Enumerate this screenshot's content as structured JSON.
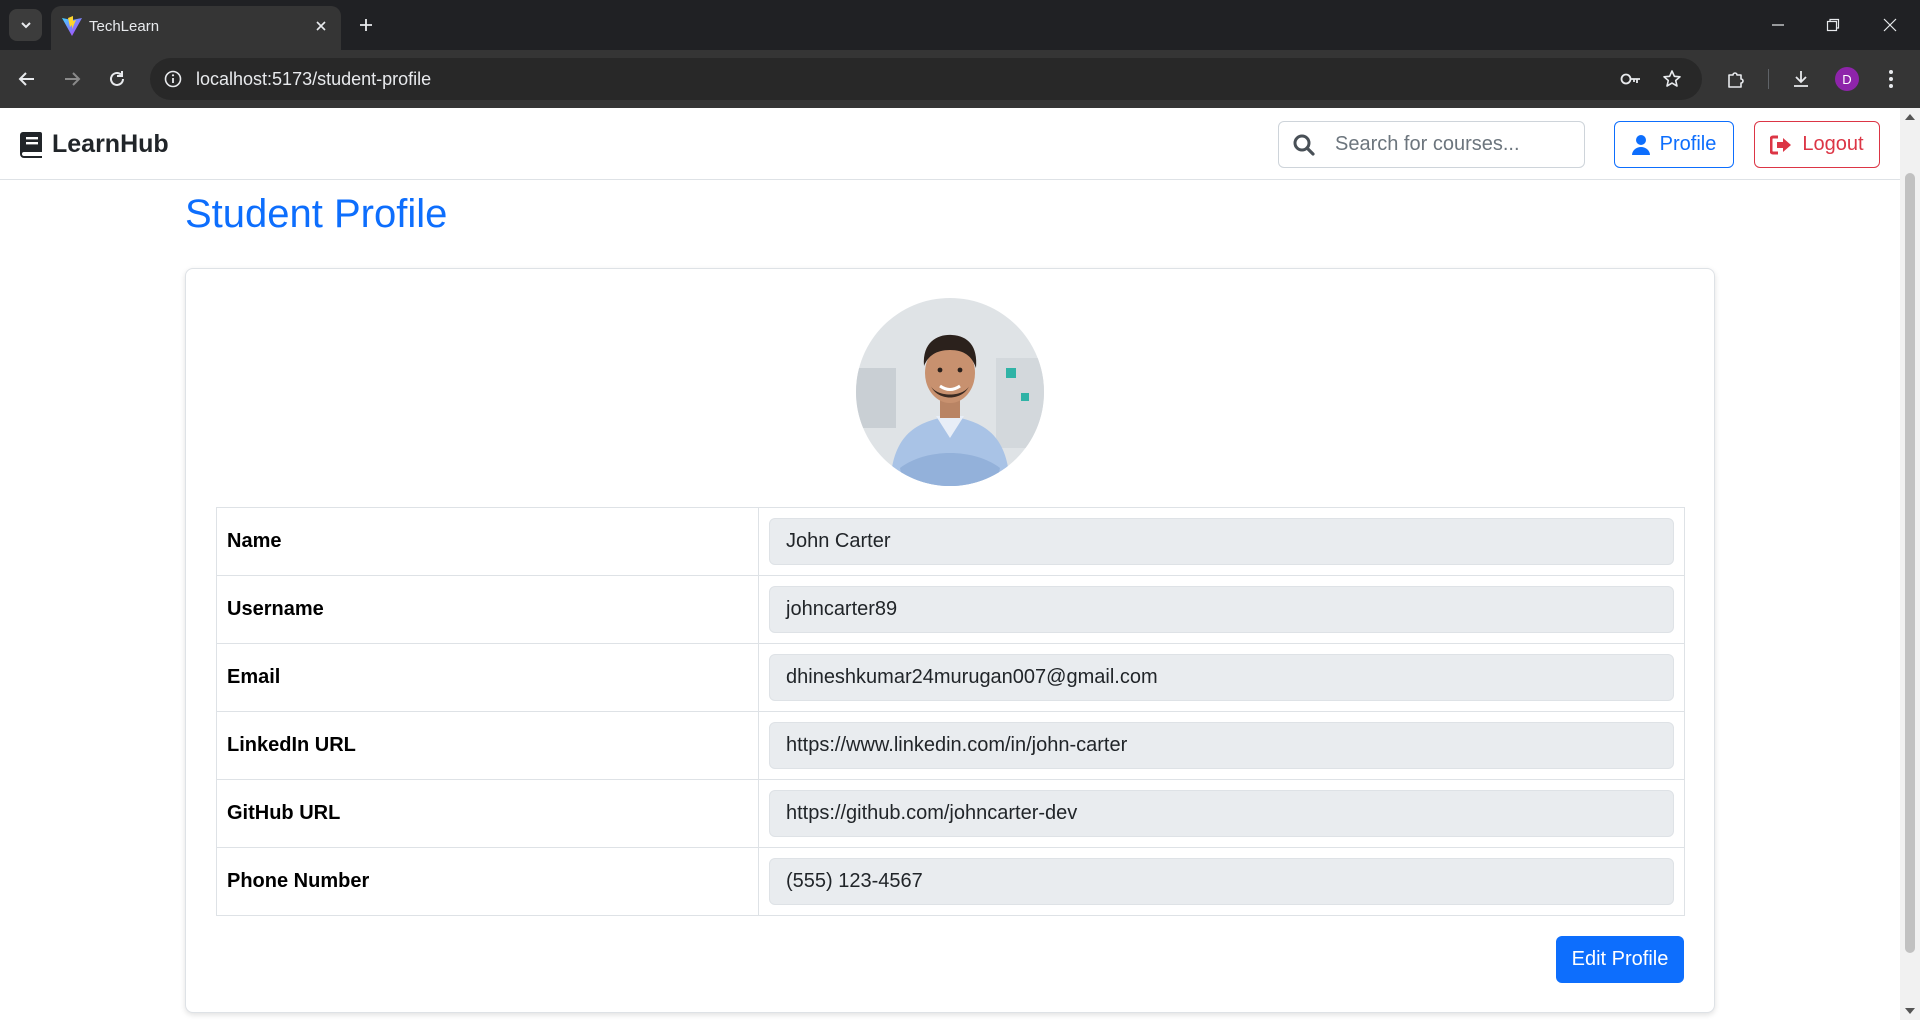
{
  "browser": {
    "tab_title": "TechLearn",
    "url": "localhost:5173/student-profile",
    "profile_initial": "D"
  },
  "navbar": {
    "brand": "LearnHub",
    "search_placeholder": "Search for courses...",
    "profile_label": "Profile",
    "logout_label": "Logout"
  },
  "page": {
    "title": "Student Profile",
    "edit_label": "Edit Profile"
  },
  "profile_fields": [
    {
      "label": "Name",
      "value": "John Carter"
    },
    {
      "label": "Username",
      "value": "johncarter89"
    },
    {
      "label": "Email",
      "value": "dhineshkumar24murugan007@gmail.com"
    },
    {
      "label": "LinkedIn URL",
      "value": "https://www.linkedin.com/in/john-carter"
    },
    {
      "label": "GitHub URL",
      "value": "https://github.com/johncarter-dev"
    },
    {
      "label": "Phone Number",
      "value": "(555) 123-4567"
    }
  ],
  "colors": {
    "primary": "#0d6efd",
    "danger": "#dc3545",
    "field_bg": "#e9ecef",
    "chrome_dark": "#202124"
  }
}
